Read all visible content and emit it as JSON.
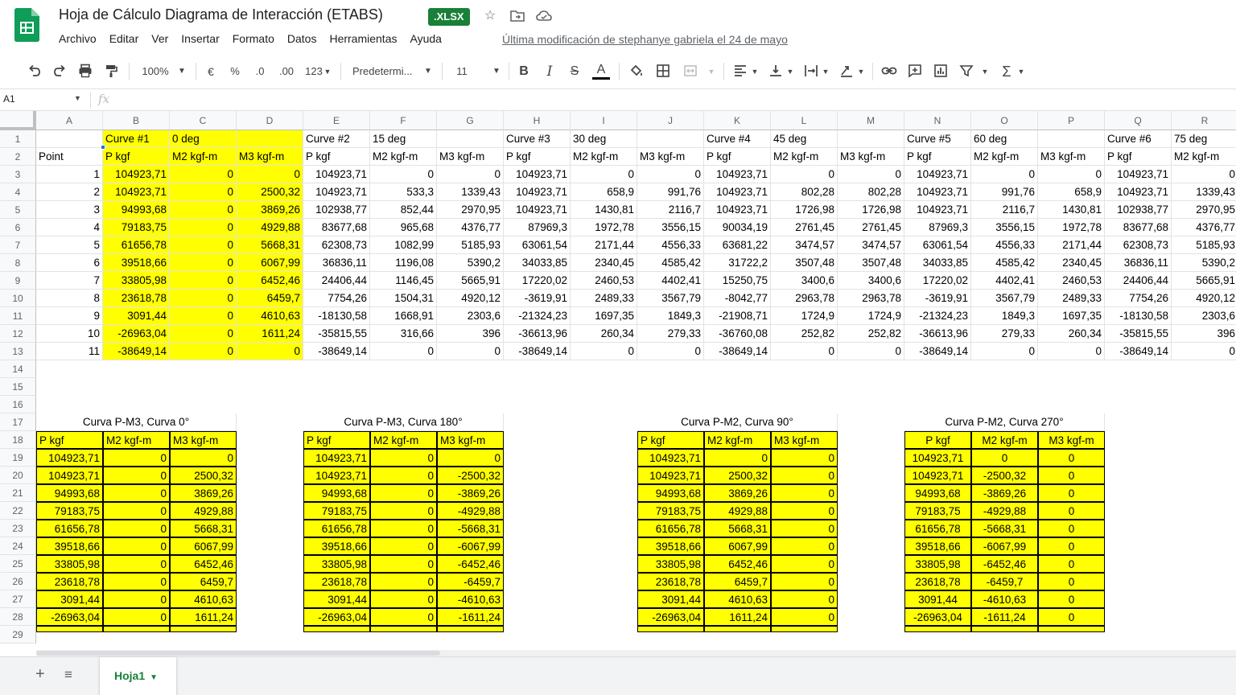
{
  "header": {
    "title": "Hoja de Cálculo Diagrama de Interacción (ETABS)",
    "badge": ".XLSX",
    "menus": [
      "Archivo",
      "Editar",
      "Ver",
      "Insertar",
      "Formato",
      "Datos",
      "Herramientas",
      "Ayuda"
    ],
    "last_edit": "Última modificación de stephanye gabriela el 24 de mayo"
  },
  "toolbar": {
    "zoom": "100%",
    "currency": "€",
    "percent": "%",
    "dec_less": ".0",
    "dec_more": ".00",
    "format_more": "123",
    "font": "Predetermi...",
    "font_size": "11"
  },
  "formula_bar": {
    "cell_ref": "A1",
    "fx": "fx"
  },
  "columns": [
    "A",
    "B",
    "C",
    "D",
    "E",
    "F",
    "G",
    "H",
    "I",
    "J",
    "K",
    "L",
    "M",
    "N",
    "O",
    "P",
    "Q",
    "R"
  ],
  "rows": [
    "1",
    "2",
    "3",
    "4",
    "5",
    "6",
    "7",
    "8",
    "9",
    "10",
    "11",
    "12",
    "13",
    "14",
    "15",
    "16",
    "17",
    "18",
    "19",
    "20",
    "21",
    "22",
    "23",
    "24",
    "25",
    "26",
    "27",
    "28",
    "29"
  ],
  "table": {
    "r1": [
      "",
      "Curve #1",
      "0 deg",
      "",
      "Curve #2",
      "15 deg",
      "",
      "Curve #3",
      "30 deg",
      "",
      "Curve #4",
      "45 deg",
      "",
      "Curve #5",
      "60 deg",
      "",
      "Curve #6",
      "75 deg"
    ],
    "r2": [
      "Point",
      "P kgf",
      "M2 kgf-m",
      "M3 kgf-m",
      "P kgf",
      "M2 kgf-m",
      "M3 kgf-m",
      "P kgf",
      "M2 kgf-m",
      "M3 kgf-m",
      "P kgf",
      "M2 kgf-m",
      "M3 kgf-m",
      "P kgf",
      "M2 kgf-m",
      "M3 kgf-m",
      "P kgf",
      "M2 kgf-m"
    ],
    "data": [
      [
        "1",
        "104923,71",
        "0",
        "0",
        "104923,71",
        "0",
        "0",
        "104923,71",
        "0",
        "0",
        "104923,71",
        "0",
        "0",
        "104923,71",
        "0",
        "0",
        "104923,71",
        "0"
      ],
      [
        "2",
        "104923,71",
        "0",
        "2500,32",
        "104923,71",
        "533,3",
        "1339,43",
        "104923,71",
        "658,9",
        "991,76",
        "104923,71",
        "802,28",
        "802,28",
        "104923,71",
        "991,76",
        "658,9",
        "104923,71",
        "1339,43"
      ],
      [
        "3",
        "94993,68",
        "0",
        "3869,26",
        "102938,77",
        "852,44",
        "2970,95",
        "104923,71",
        "1430,81",
        "2116,7",
        "104923,71",
        "1726,98",
        "1726,98",
        "104923,71",
        "2116,7",
        "1430,81",
        "102938,77",
        "2970,95"
      ],
      [
        "4",
        "79183,75",
        "0",
        "4929,88",
        "83677,68",
        "965,68",
        "4376,77",
        "87969,3",
        "1972,78",
        "3556,15",
        "90034,19",
        "2761,45",
        "2761,45",
        "87969,3",
        "3556,15",
        "1972,78",
        "83677,68",
        "4376,77"
      ],
      [
        "5",
        "61656,78",
        "0",
        "5668,31",
        "62308,73",
        "1082,99",
        "5185,93",
        "63061,54",
        "2171,44",
        "4556,33",
        "63681,22",
        "3474,57",
        "3474,57",
        "63061,54",
        "4556,33",
        "2171,44",
        "62308,73",
        "5185,93"
      ],
      [
        "6",
        "39518,66",
        "0",
        "6067,99",
        "36836,11",
        "1196,08",
        "5390,2",
        "34033,85",
        "2340,45",
        "4585,42",
        "31722,2",
        "3507,48",
        "3507,48",
        "34033,85",
        "4585,42",
        "2340,45",
        "36836,11",
        "5390,2"
      ],
      [
        "7",
        "33805,98",
        "0",
        "6452,46",
        "24406,44",
        "1146,45",
        "5665,91",
        "17220,02",
        "2460,53",
        "4402,41",
        "15250,75",
        "3400,6",
        "3400,6",
        "17220,02",
        "4402,41",
        "2460,53",
        "24406,44",
        "5665,91"
      ],
      [
        "8",
        "23618,78",
        "0",
        "6459,7",
        "7754,26",
        "1504,31",
        "4920,12",
        "-3619,91",
        "2489,33",
        "3567,79",
        "-8042,77",
        "2963,78",
        "2963,78",
        "-3619,91",
        "3567,79",
        "2489,33",
        "7754,26",
        "4920,12"
      ],
      [
        "9",
        "3091,44",
        "0",
        "4610,63",
        "-18130,58",
        "1668,91",
        "2303,6",
        "-21324,23",
        "1697,35",
        "1849,3",
        "-21908,71",
        "1724,9",
        "1724,9",
        "-21324,23",
        "1849,3",
        "1697,35",
        "-18130,58",
        "2303,6"
      ],
      [
        "10",
        "-26963,04",
        "0",
        "1611,24",
        "-35815,55",
        "316,66",
        "396",
        "-36613,96",
        "260,34",
        "279,33",
        "-36760,08",
        "252,82",
        "252,82",
        "-36613,96",
        "279,33",
        "260,34",
        "-35815,55",
        "396"
      ],
      [
        "11",
        "-38649,14",
        "0",
        "0",
        "-38649,14",
        "0",
        "0",
        "-38649,14",
        "0",
        "0",
        "-38649,14",
        "0",
        "0",
        "-38649,14",
        "0",
        "0",
        "-38649,14",
        "0"
      ]
    ]
  },
  "curves": [
    {
      "title": "Curva P-M3, Curva  0°",
      "headers": [
        "P  kgf",
        "M2  kgf-m",
        "M3  kgf-m"
      ],
      "rows": [
        [
          "104923,71",
          "0",
          "0"
        ],
        [
          "104923,71",
          "0",
          "2500,32"
        ],
        [
          "94993,68",
          "0",
          "3869,26"
        ],
        [
          "79183,75",
          "0",
          "4929,88"
        ],
        [
          "61656,78",
          "0",
          "5668,31"
        ],
        [
          "39518,66",
          "0",
          "6067,99"
        ],
        [
          "33805,98",
          "0",
          "6452,46"
        ],
        [
          "23618,78",
          "0",
          "6459,7"
        ],
        [
          "3091,44",
          "0",
          "4610,63"
        ],
        [
          "-26963,04",
          "0",
          "1611,24"
        ]
      ]
    },
    {
      "title": "Curva P-M3, Curva  180°",
      "headers": [
        "P  kgf",
        "M2  kgf-m",
        "M3  kgf-m"
      ],
      "rows": [
        [
          "104923,71",
          "0",
          "0"
        ],
        [
          "104923,71",
          "0",
          "-2500,32"
        ],
        [
          "94993,68",
          "0",
          "-3869,26"
        ],
        [
          "79183,75",
          "0",
          "-4929,88"
        ],
        [
          "61656,78",
          "0",
          "-5668,31"
        ],
        [
          "39518,66",
          "0",
          "-6067,99"
        ],
        [
          "33805,98",
          "0",
          "-6452,46"
        ],
        [
          "23618,78",
          "0",
          "-6459,7"
        ],
        [
          "3091,44",
          "0",
          "-4610,63"
        ],
        [
          "-26963,04",
          "0",
          "-1611,24"
        ]
      ]
    },
    {
      "title": "Curva P-M2, Curva 90°",
      "headers": [
        "P  kgf",
        "M2  kgf-m",
        "M3  kgf-m"
      ],
      "rows": [
        [
          "104923,71",
          "0",
          "0"
        ],
        [
          "104923,71",
          "2500,32",
          "0"
        ],
        [
          "94993,68",
          "3869,26",
          "0"
        ],
        [
          "79183,75",
          "4929,88",
          "0"
        ],
        [
          "61656,78",
          "5668,31",
          "0"
        ],
        [
          "39518,66",
          "6067,99",
          "0"
        ],
        [
          "33805,98",
          "6452,46",
          "0"
        ],
        [
          "23618,78",
          "6459,7",
          "0"
        ],
        [
          "3091,44",
          "4610,63",
          "0"
        ],
        [
          "-26963,04",
          "1611,24",
          "0"
        ]
      ]
    },
    {
      "title": "Curva P-M2, Curva 270°",
      "headers": [
        "P  kgf",
        "M2  kgf-m",
        "M3  kgf-m"
      ],
      "rows": [
        [
          "104923,71",
          "0",
          "0"
        ],
        [
          "104923,71",
          "-2500,32",
          "0"
        ],
        [
          "94993,68",
          "-3869,26",
          "0"
        ],
        [
          "79183,75",
          "-4929,88",
          "0"
        ],
        [
          "61656,78",
          "-5668,31",
          "0"
        ],
        [
          "39518,66",
          "-6067,99",
          "0"
        ],
        [
          "33805,98",
          "-6452,46",
          "0"
        ],
        [
          "23618,78",
          "-6459,7",
          "0"
        ],
        [
          "3091,44",
          "-4610,63",
          "0"
        ],
        [
          "-26963,04",
          "-1611,24",
          "0"
        ]
      ]
    }
  ],
  "sheets": {
    "active": "Hoja1"
  },
  "colors": {
    "highlight": "#ffff00",
    "brand": "#188038"
  }
}
